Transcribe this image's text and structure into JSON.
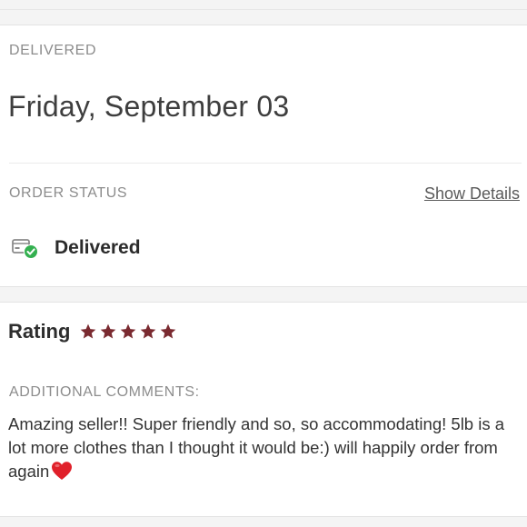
{
  "delivery": {
    "section_label": "DELIVERED",
    "date": "Friday, September 03"
  },
  "order_status": {
    "section_label": "ORDER STATUS",
    "show_details_label": "Show Details",
    "status_text": "Delivered",
    "status_icon": "package-delivered-check-icon"
  },
  "rating": {
    "label": "Rating",
    "stars": 5,
    "max_stars": 5,
    "star_color": "#7a2a30"
  },
  "comments": {
    "section_label": "ADDITIONAL COMMENTS:",
    "text": "Amazing seller!! Super friendly and so, so accommodating! 5lb is a lot more clothes than I thought it would be:) will happily order from again",
    "emoji": "heart-emoji-icon"
  },
  "colors": {
    "check_green": "#34b050",
    "heart_red": "#e0202a"
  }
}
